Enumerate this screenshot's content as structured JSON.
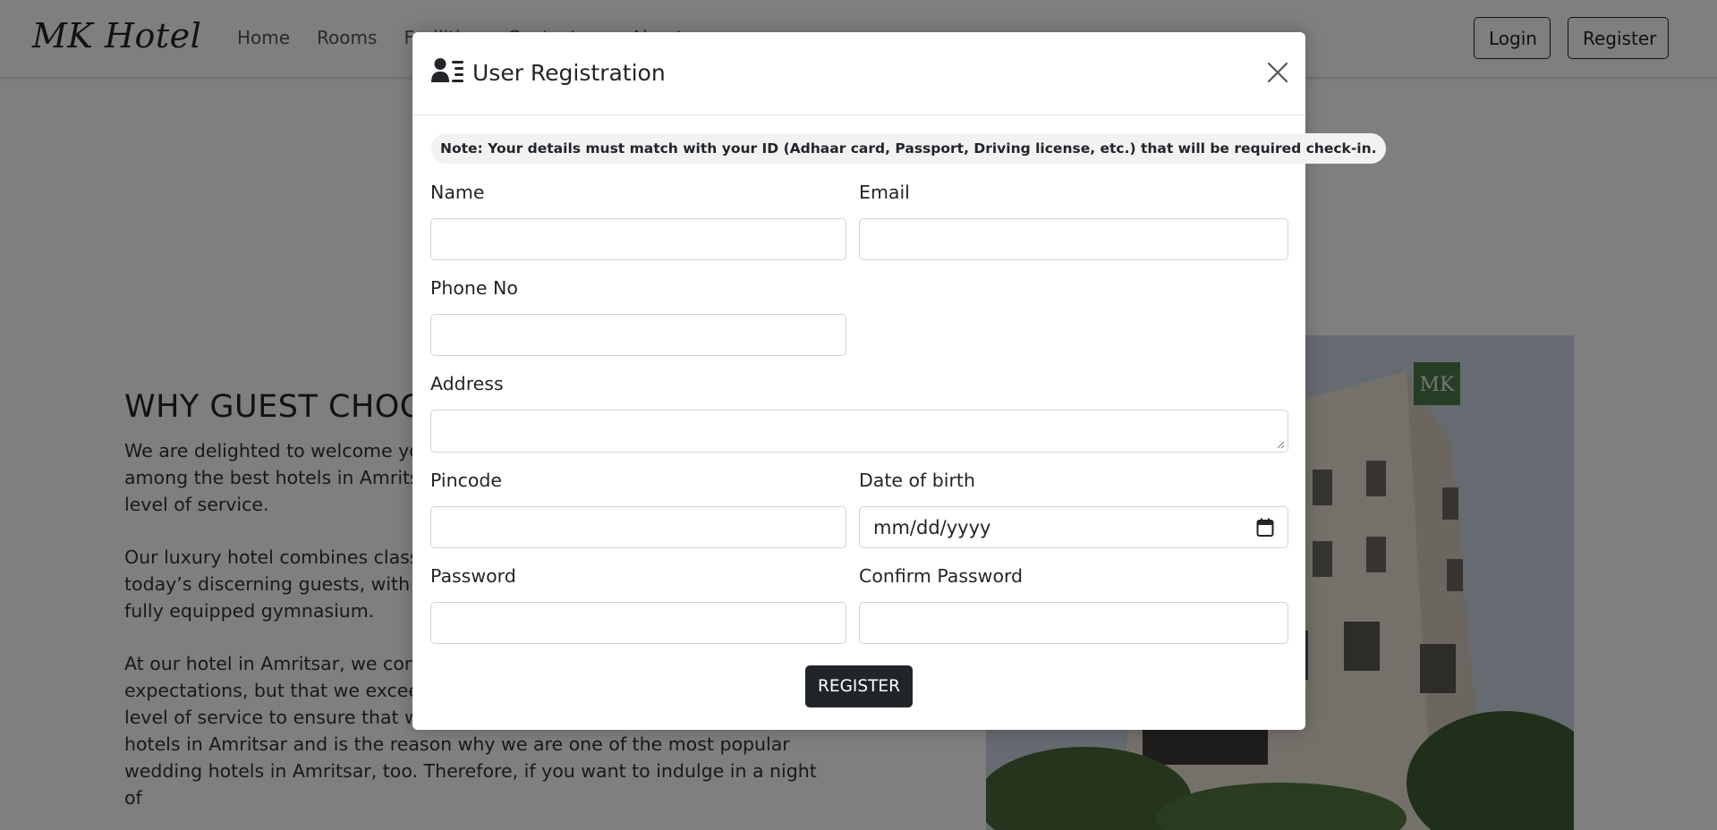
{
  "navbar": {
    "brand": "MK Hotel",
    "links": [
      "Home",
      "Rooms",
      "Facilities",
      "Contact us",
      "About"
    ],
    "login_label": "Login",
    "register_label": "Register"
  },
  "background": {
    "heading": "WHY GUEST CHOOSE MK HOTEL?",
    "paragraphs": [
      "We are delighted to welcome you to our hotel in Amritsar, MK Hotel. We rank among the best hotels in Amritsar and have a distinctive style and unrivalled level of service.",
      "Our luxury hotel combines classic charm with all the facilities required by today’s discerning guests, with elegant rooms, fantastic restaurants and a fully equipped gymnasium.",
      "At our hotel in Amritsar, we continuously strive to not only meet our guests’ expectations, but that we exceed them. We take pride in offering the highest level of service to ensure that we continue to be one of the leading 4 star hotels in Amritsar and is the reason why we are one of the most popular wedding hotels in Amritsar, too. Therefore, if you want to indulge in a night of"
    ]
  },
  "modal": {
    "title": "User Registration",
    "title_icon": "user-list-icon",
    "close_icon": "close-icon",
    "note": "Note: Your details must match with your ID (Adhaar card, Passport, Driving license, etc.) that will be required check-in.",
    "fields": {
      "name": {
        "label": "Name",
        "value": ""
      },
      "email": {
        "label": "Email",
        "value": ""
      },
      "phone": {
        "label": "Phone No",
        "value": ""
      },
      "address": {
        "label": "Address",
        "value": ""
      },
      "pincode": {
        "label": "Pincode",
        "value": ""
      },
      "dob": {
        "label": "Date of birth",
        "placeholder": "mm/dd/yyyy"
      },
      "password": {
        "label": "Password",
        "value": ""
      },
      "confirm_password": {
        "label": "Confirm Password",
        "value": ""
      }
    },
    "submit_label": "REGISTER"
  },
  "colors": {
    "dark": "#212529",
    "backdrop": "rgba(0,0,0,0.5)",
    "input_border": "#ced4da"
  }
}
